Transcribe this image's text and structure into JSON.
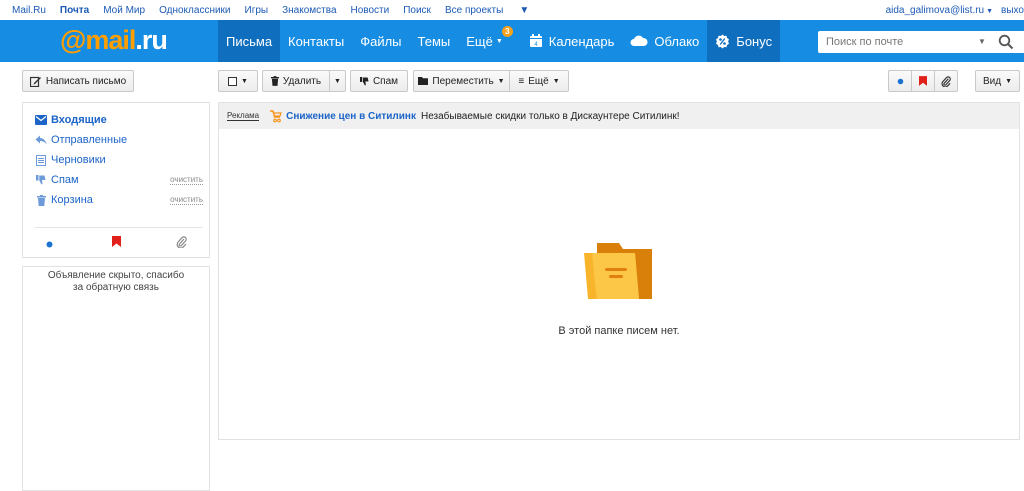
{
  "portal": {
    "links": [
      "Mail.Ru",
      "Почта",
      "Мой Мир",
      "Одноклассники",
      "Игры",
      "Знакомства",
      "Новости",
      "Поиск",
      "Все проекты"
    ],
    "user_email": "aida_galimova@list.ru",
    "logout": "выхо"
  },
  "header": {
    "logo_at": "@mail",
    "logo_dom": ".ru",
    "nav": [
      {
        "label": "Письма",
        "active": true
      },
      {
        "label": "Контакты"
      },
      {
        "label": "Файлы"
      },
      {
        "label": "Темы"
      },
      {
        "label": "Ещё",
        "badge": "3"
      },
      {
        "label": "Календарь",
        "icon": "calendar-icon"
      },
      {
        "label": "Облако",
        "icon": "cloud-icon"
      },
      {
        "label": "Бонус",
        "icon": "percent-icon"
      }
    ],
    "search_placeholder": "Поиск по почте"
  },
  "compose": {
    "label": "Написать письмо",
    "icon": "pencil-icon"
  },
  "folders": [
    {
      "label": "Входящие",
      "icon": "inbox-icon",
      "active": true
    },
    {
      "label": "Отправленные",
      "icon": "reply-icon"
    },
    {
      "label": "Черновики",
      "icon": "draft-icon"
    },
    {
      "label": "Спам",
      "icon": "thumbs-down-icon",
      "action": "очистить"
    },
    {
      "label": "Корзина",
      "icon": "trash-icon",
      "action": "очистить"
    }
  ],
  "filters": [
    "unread-dot-icon",
    "flag-icon",
    "paperclip-icon"
  ],
  "ad_notice": [
    "Объявление скрыто, спасибо",
    "за обратную связь"
  ],
  "toolbar": {
    "delete": "Удалить",
    "spam": "Спам",
    "move": "Переместить",
    "more": "Ещё",
    "view": "Вид"
  },
  "adline": {
    "tag": "Реклама",
    "headline": "Снижение цен в Ситилинк",
    "text": "Незабываемые скидки только в Дискаунтере Ситилинк!"
  },
  "empty_message": "В этой папке писем нет.",
  "colors": {
    "header_blue": "#168de2",
    "header_active": "#0f6ebd",
    "logo_orange": "#ff9e00",
    "link_blue": "#1c64c8",
    "flag_red": "#e0211b",
    "folder_orange": "#f7b51e"
  }
}
